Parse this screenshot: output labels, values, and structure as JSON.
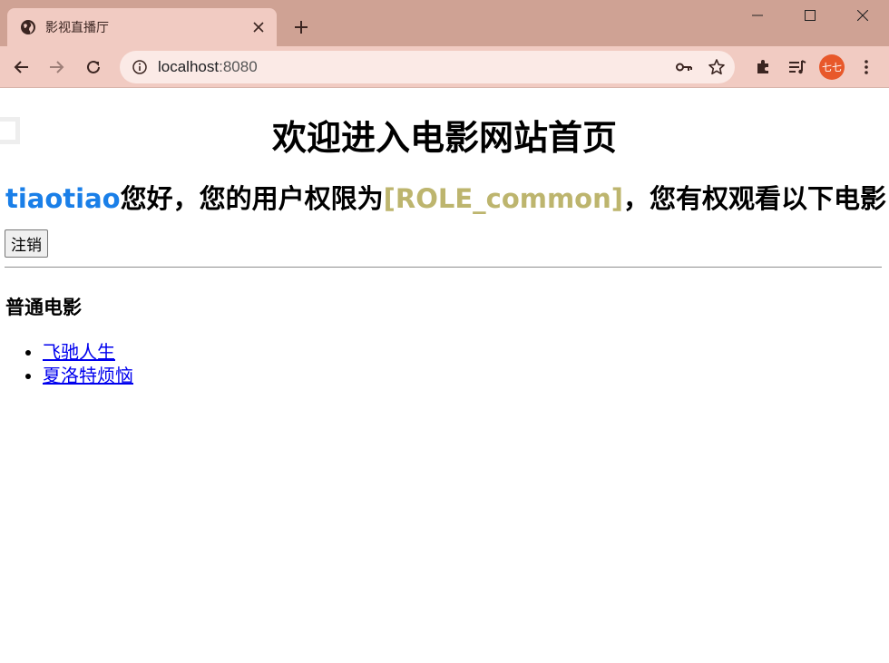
{
  "browser": {
    "tab_title": "影视直播厅",
    "url_host": "localhost",
    "url_port": ":8080",
    "avatar_text": "七七",
    "avatar_color": "#e8582a",
    "chrome_color": "#cfa294",
    "toolbar_color": "#f1cbc2"
  },
  "page": {
    "heading": "欢迎进入电影网站首页",
    "greeting": {
      "username": "tiaotiao",
      "text1": "您好，您的用户权限为",
      "role": "[ROLE_common]",
      "text2": "，您有权观看以下电影",
      "username_color": "#1a7fe8",
      "role_color": "#bdb56e"
    },
    "logout_label": "注销",
    "section_title": "普通电影",
    "movies": [
      "飞驰人生",
      "夏洛特烦恼"
    ]
  }
}
